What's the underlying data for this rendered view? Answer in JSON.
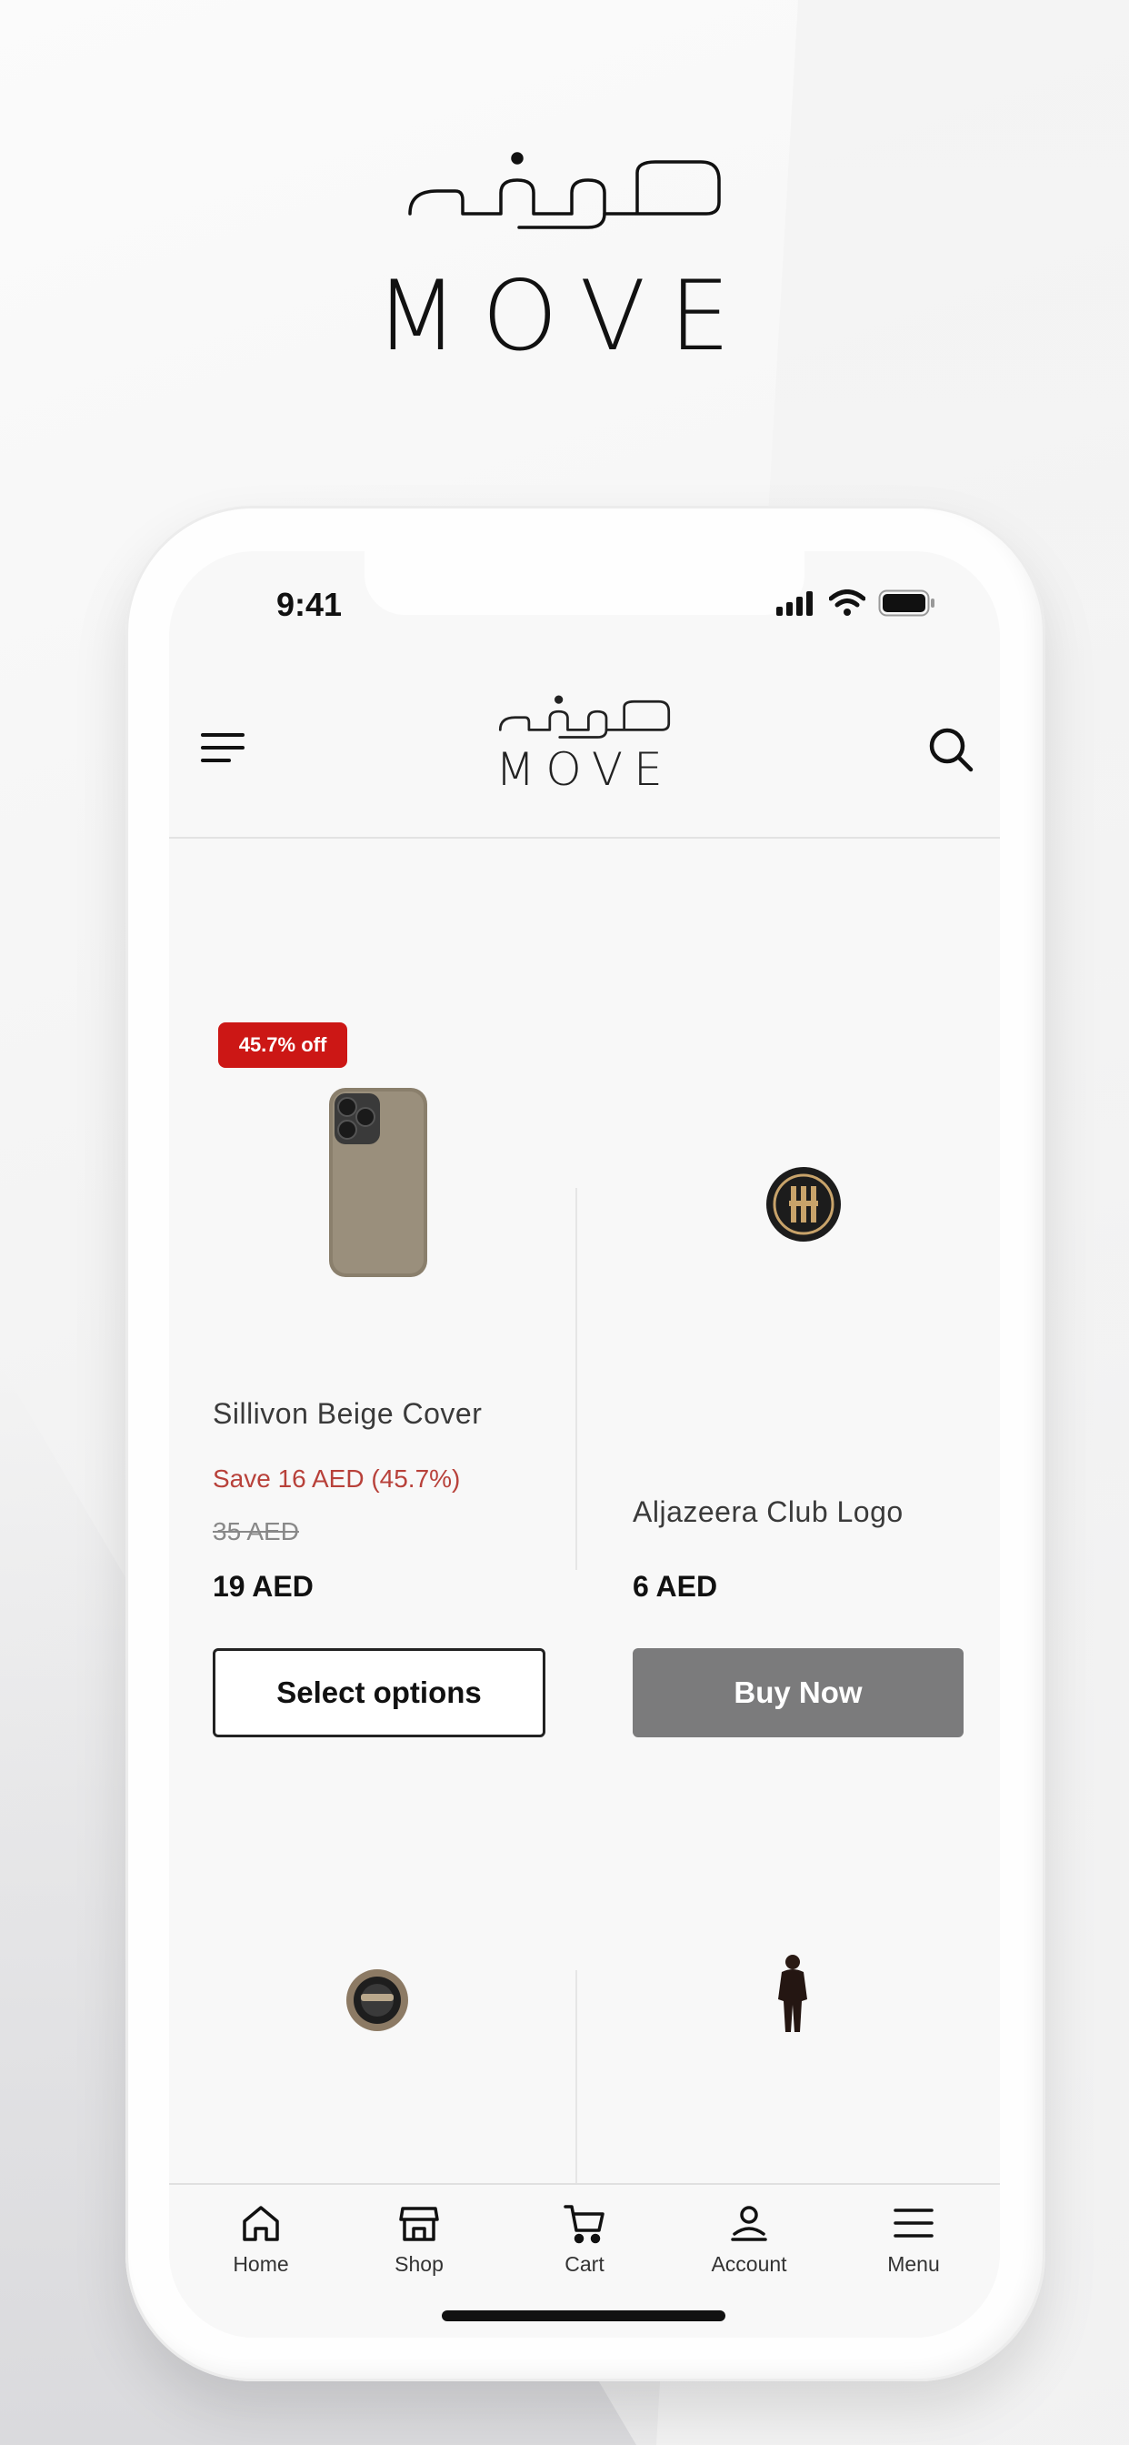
{
  "brand": {
    "arabic": "موف",
    "name": "MOVE"
  },
  "status_bar": {
    "time": "9:41"
  },
  "header": {
    "logo_arabic": "موف",
    "logo_name": "MOVE"
  },
  "products": [
    {
      "badge": "45.7% off",
      "name": "Sillivon Beige Cover",
      "save_text": "Save 16 AED (45.7%)",
      "old_price": "35 AED",
      "price": "19 AED",
      "button": "Select options"
    },
    {
      "name": "Aljazeera Club Logo",
      "price": "6 AED",
      "button": "Buy Now"
    }
  ],
  "tabs": [
    {
      "label": "Home",
      "icon": "home-icon"
    },
    {
      "label": "Shop",
      "icon": "shop-icon"
    },
    {
      "label": "Cart",
      "icon": "cart-icon"
    },
    {
      "label": "Account",
      "icon": "account-icon"
    },
    {
      "label": "Menu",
      "icon": "menu-icon"
    }
  ],
  "colors": {
    "badge": "#cc1715",
    "save_text": "#b8413a",
    "buy_button": "#7b7b7c"
  }
}
